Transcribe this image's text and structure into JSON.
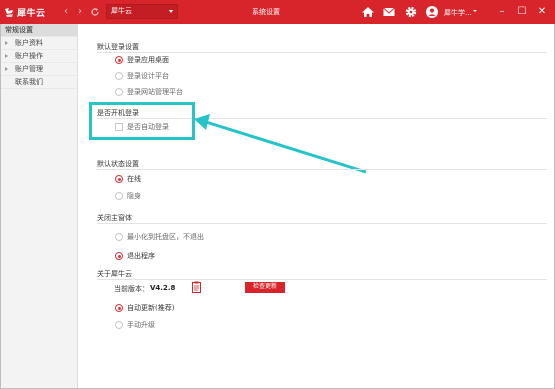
{
  "app": {
    "name": "犀牛云",
    "account": "犀牛云",
    "window_title": "系统设置",
    "username": "犀牛学...",
    "brand_color": "#d8252b"
  },
  "titlebar_icons": [
    "back-icon",
    "forward-icon",
    "refresh-icon",
    "home-icon",
    "mail-icon",
    "gear-icon",
    "user-icon",
    "minimize-icon",
    "maximize-icon",
    "close-icon"
  ],
  "sidebar": {
    "items": [
      {
        "label": "常规设置",
        "active": true
      },
      {
        "label": "账户资料",
        "arrow": true
      },
      {
        "label": "账户操作",
        "arrow": true
      },
      {
        "label": "账户管理",
        "arrow": true
      },
      {
        "label": "联系我们"
      }
    ]
  },
  "sections": {
    "login": {
      "title": "默认登录设置",
      "options": [
        "登录应用桌面",
        "登录设计平台",
        "登录网站管理平台"
      ],
      "selected": 0
    },
    "startup": {
      "title": "是否开机登录",
      "checkbox_label": "是否自动登录"
    },
    "status": {
      "title": "默认状态设置",
      "options": [
        "在线",
        "隐身"
      ],
      "selected": 0
    },
    "close": {
      "title": "关闭主窗体",
      "options": [
        "最小化到托盘区，不退出",
        "退出程序"
      ],
      "selected": 1
    },
    "about": {
      "title": "关于犀牛云",
      "version_label": "当前版本：",
      "version_value": "V4.2.8",
      "check_update_label": "检查更新",
      "options": [
        "自动更新(推荐)",
        "手动升级"
      ],
      "selected": 0
    }
  },
  "annotation": {
    "highlight_color": "#25c4c9"
  }
}
